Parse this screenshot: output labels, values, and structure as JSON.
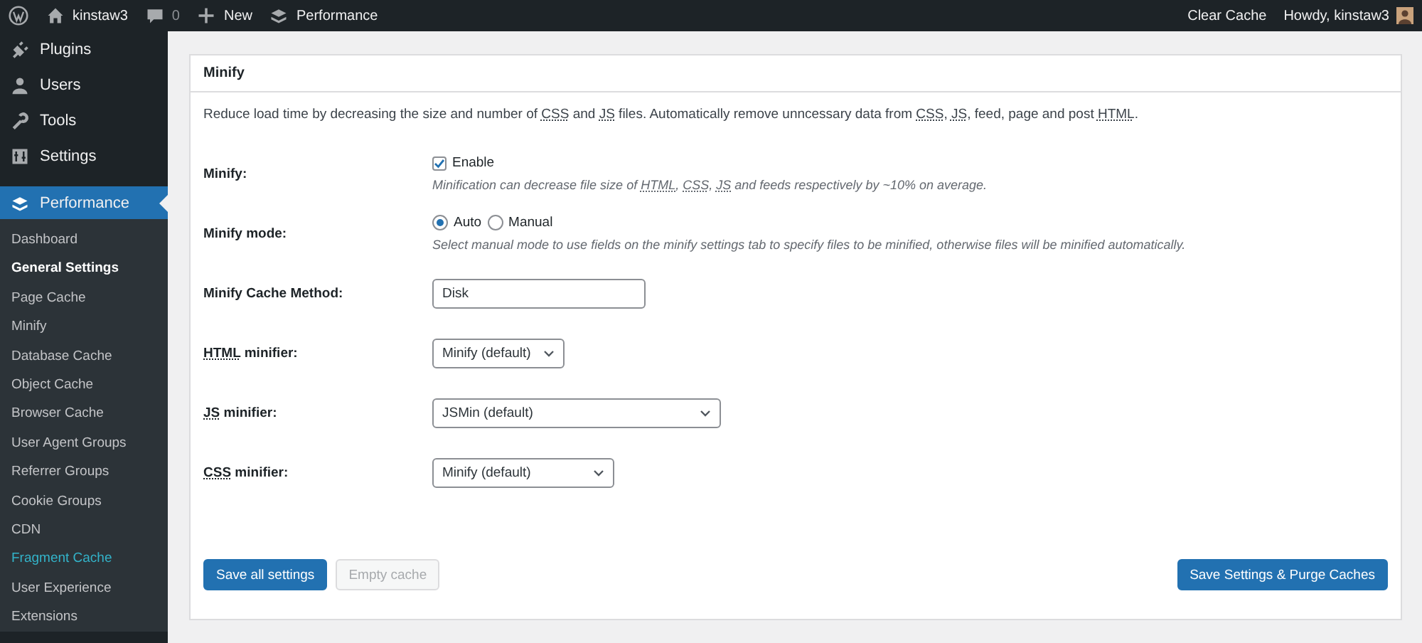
{
  "admin_bar": {
    "left": [
      {
        "kind": "wp-logo"
      },
      {
        "kind": "home",
        "label": "kinstaw3"
      },
      {
        "kind": "comments",
        "label": "0"
      },
      {
        "kind": "new",
        "label": "New"
      },
      {
        "kind": "plugin",
        "label": "Performance"
      }
    ],
    "right": [
      {
        "kind": "text",
        "label": "Clear Cache"
      },
      {
        "kind": "account",
        "label": "Howdy, kinstaw3"
      }
    ]
  },
  "sidebar": {
    "items": [
      {
        "kind": "plugins",
        "label": "Plugins",
        "selected": false
      },
      {
        "kind": "users",
        "label": "Users",
        "selected": false
      },
      {
        "kind": "tools",
        "label": "Tools",
        "selected": false
      },
      {
        "kind": "settings",
        "label": "Settings",
        "selected": false
      },
      {
        "kind": "performance",
        "label": "Performance",
        "selected": true
      }
    ],
    "submenu": [
      {
        "label": "Dashboard",
        "selected": false,
        "hovered": false
      },
      {
        "label": "General Settings",
        "selected": true,
        "hovered": false
      },
      {
        "label": "Page Cache",
        "selected": false,
        "hovered": false
      },
      {
        "label": "Minify",
        "selected": false,
        "hovered": false
      },
      {
        "label": "Database Cache",
        "selected": false,
        "hovered": false
      },
      {
        "label": "Object Cache",
        "selected": false,
        "hovered": false
      },
      {
        "label": "Browser Cache",
        "selected": false,
        "hovered": false
      },
      {
        "label": "User Agent Groups",
        "selected": false,
        "hovered": false
      },
      {
        "label": "Referrer Groups",
        "selected": false,
        "hovered": false
      },
      {
        "label": "Cookie Groups",
        "selected": false,
        "hovered": false
      },
      {
        "label": "CDN",
        "selected": false,
        "hovered": false
      },
      {
        "label": "Fragment Cache",
        "selected": false,
        "hovered": true
      },
      {
        "label": "User Experience",
        "selected": false,
        "hovered": false
      },
      {
        "label": "Extensions",
        "selected": false,
        "hovered": false
      }
    ]
  },
  "panel": {
    "title": "Minify",
    "description": [
      {
        "text": "Reduce load time by decreasing the size and number of "
      },
      {
        "text": "CSS",
        "abbr": true
      },
      {
        "text": " and "
      },
      {
        "text": "JS",
        "abbr": true
      },
      {
        "text": " files. Automatically remove unncessary data from "
      },
      {
        "text": "CSS",
        "abbr": true
      },
      {
        "text": ", "
      },
      {
        "text": "JS",
        "abbr": true
      },
      {
        "text": ", feed, page and post "
      },
      {
        "text": "HTML",
        "abbr": true
      },
      {
        "text": "."
      }
    ],
    "rows": [
      {
        "kind": "checkbox",
        "label": [
          {
            "text": "Minify:"
          }
        ],
        "option": "Enable",
        "checked": true,
        "help": [
          {
            "text": "Minification can decrease file size of "
          },
          {
            "text": "HTML",
            "abbr": true,
            "after": ", "
          },
          {
            "text": "CSS",
            "abbr": true,
            "after": ", "
          },
          {
            "text": "JS",
            "abbr": true
          },
          {
            "text": " and feeds respectively by ~10% on average."
          }
        ]
      },
      {
        "kind": "radio",
        "label": [
          {
            "text": "Minify mode:"
          }
        ],
        "options": [
          {
            "label": "Auto",
            "selected": true
          },
          {
            "label": "Manual",
            "selected": false
          }
        ],
        "help": [
          {
            "text": "Select manual mode to use fields on the minify settings tab to specify files to be minified, otherwise files will be minified automatically."
          }
        ]
      },
      {
        "kind": "field",
        "label": [
          {
            "text": "Minify Cache Method:"
          }
        ],
        "value": "Disk"
      },
      {
        "kind": "select",
        "label": [
          {
            "text": "HTML",
            "abbr": true
          },
          {
            "text": " minifier:"
          }
        ],
        "value": "Minify (default)"
      },
      {
        "kind": "select",
        "label": [
          {
            "text": "JS",
            "abbr": true
          },
          {
            "text": " minifier:"
          }
        ],
        "value": "JSMin (default)"
      },
      {
        "kind": "select",
        "label": [
          {
            "text": "CSS",
            "abbr": true
          },
          {
            "text": " minifier:"
          }
        ],
        "value": "Minify (default)"
      }
    ],
    "buttons": [
      {
        "label": "Save all settings",
        "disabled": false
      },
      {
        "label": "Empty cache",
        "disabled": true
      }
    ],
    "right_button": {
      "label": "Save Settings & Purge Caches",
      "disabled": false
    }
  }
}
